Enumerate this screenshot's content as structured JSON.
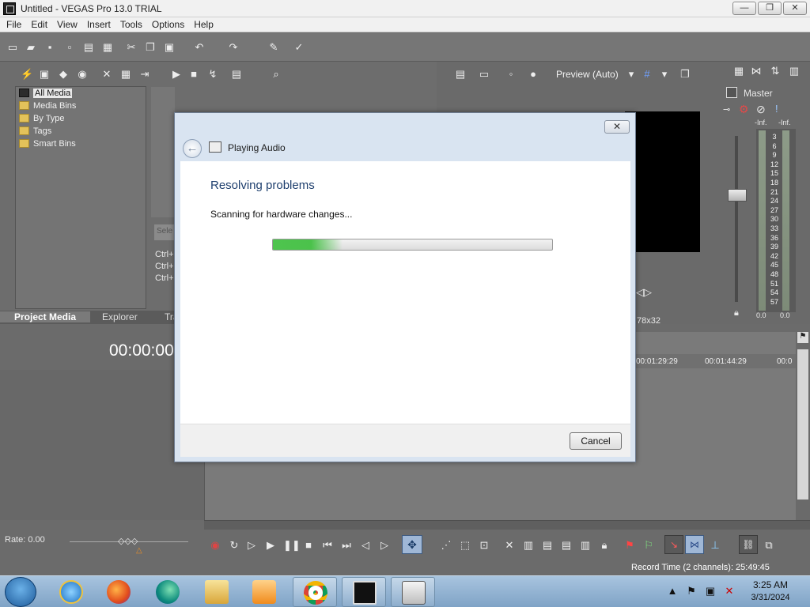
{
  "window": {
    "title": "Untitled - VEGAS Pro 13.0 TRIAL",
    "controls": {
      "minimize": "—",
      "maximize": "❐",
      "close": "✕"
    }
  },
  "menu": [
    "File",
    "Edit",
    "View",
    "Insert",
    "Tools",
    "Options",
    "Help"
  ],
  "project_media": {
    "tree": [
      {
        "label": "All Media",
        "selected": true
      },
      {
        "label": "Media Bins"
      },
      {
        "label": "By Type",
        "expander": "+"
      },
      {
        "label": "Tags"
      },
      {
        "label": "Smart Bins"
      }
    ],
    "search_placeholder": "Sele",
    "shortcuts": [
      "Ctrl+",
      "Ctrl+",
      "Ctrl+"
    ],
    "tabs": [
      "Project Media",
      "Explorer",
      "Tra"
    ]
  },
  "preview": {
    "mode": "Preview (Auto)",
    "resolution_fragment": "78x32"
  },
  "mixer": {
    "title": "Master",
    "left_peak": "-Inf.",
    "right_peak": "-Inf.",
    "scale": [
      "3",
      "6",
      "9",
      "12",
      "15",
      "18",
      "21",
      "24",
      "27",
      "30",
      "33",
      "36",
      "39",
      "42",
      "45",
      "48",
      "51",
      "54",
      "57"
    ],
    "left_value": "0.0",
    "right_value": "0.0"
  },
  "timeline": {
    "timecode": "00:00:00",
    "ruler": [
      "00:01:29:29",
      "00:01:44:29",
      "00:0"
    ],
    "rate_label": "Rate: 0.00",
    "record_time": "Record Time (2 channels): 25:49:45"
  },
  "dialog": {
    "title": "Playing Audio",
    "heading": "Resolving problems",
    "message": "Scanning for hardware changes...",
    "progress": 0.25,
    "cancel_label": "Cancel",
    "close_label": "✕"
  },
  "taskbar": {
    "apps": [
      "internet-explorer",
      "firefox",
      "edge",
      "file-explorer",
      "media-player",
      "chrome",
      "vegas-pro",
      "utility"
    ],
    "clock_time": "3:25 AM",
    "clock_date": "3/31/2024"
  }
}
